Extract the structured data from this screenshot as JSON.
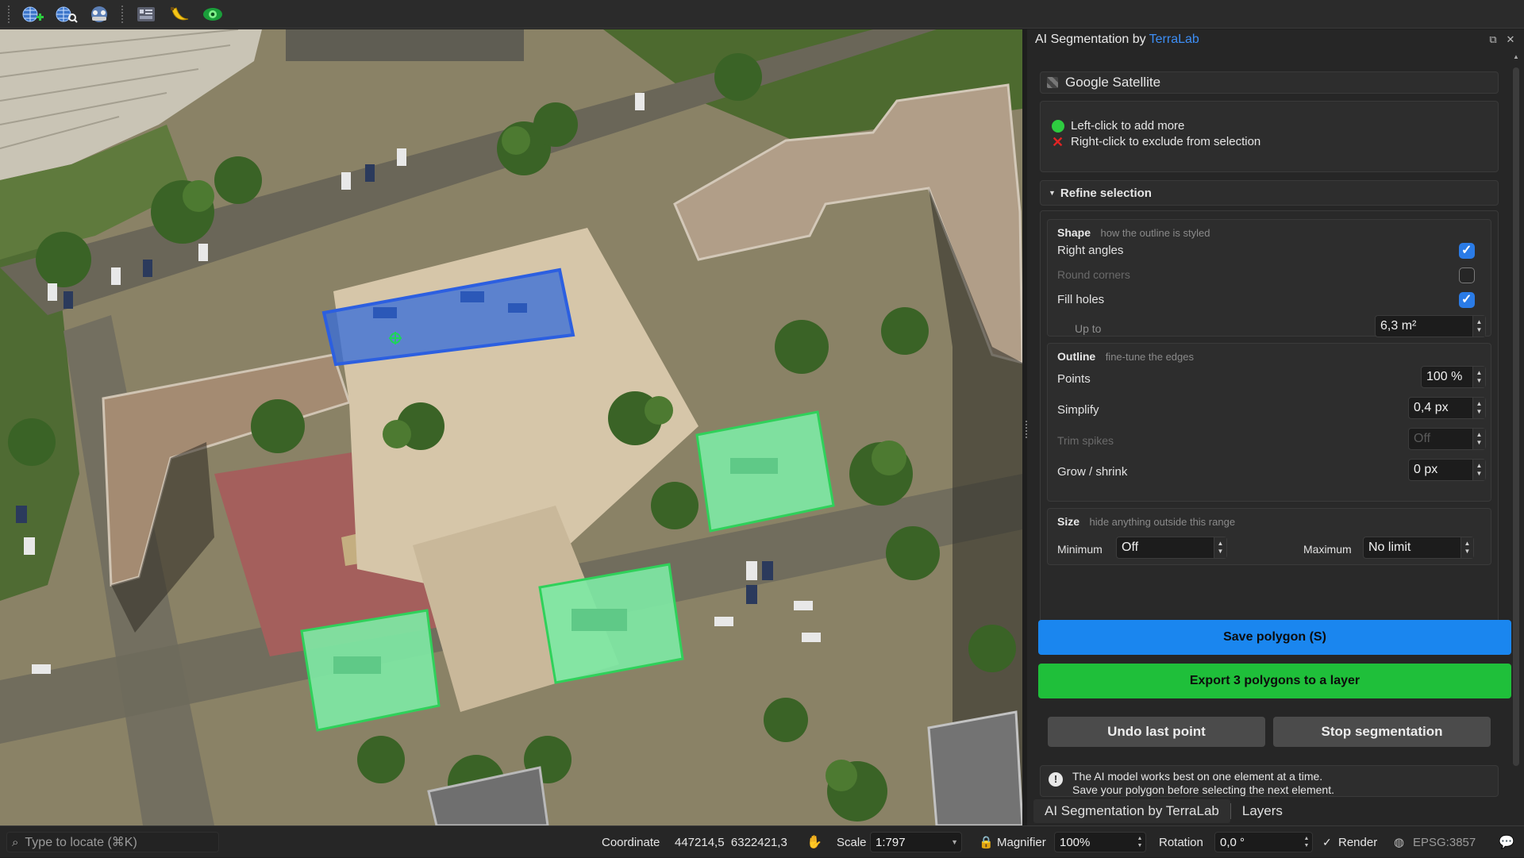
{
  "toolbar": {
    "icons": [
      "add-globe-icon",
      "zoom-globe-icon",
      "segmentation-icon",
      "layout-icon",
      "banana-icon",
      "eye-icon"
    ]
  },
  "panel": {
    "title": "AI Segmentation by",
    "brand": "TerraLab",
    "layer": "Google Satellite",
    "instructions": {
      "left": "Left-click to add more",
      "right": "Right-click to exclude from selection"
    },
    "refine": {
      "title": "Refine selection",
      "shape": {
        "title": "Shape",
        "hint": "how the outline is styled",
        "right_angles": {
          "label": "Right angles",
          "checked": true
        },
        "round_corners": {
          "label": "Round corners",
          "checked": false
        },
        "fill_holes": {
          "label": "Fill holes",
          "checked": true
        },
        "up_to": {
          "label": "Up to",
          "value": "6,3 m²"
        }
      },
      "outline": {
        "title": "Outline",
        "hint": "fine-tune the edges",
        "points": {
          "label": "Points",
          "value": "100 %"
        },
        "simplify": {
          "label": "Simplify",
          "value": "0,4 px"
        },
        "trim_spikes": {
          "label": "Trim spikes",
          "value": "Off"
        },
        "grow_shrink": {
          "label": "Grow / shrink",
          "value": "0 px"
        }
      },
      "size": {
        "title": "Size",
        "hint": "hide anything outside this range",
        "minimum": {
          "label": "Minimum",
          "value": "Off"
        },
        "maximum": {
          "label": "Maximum",
          "value": "No limit"
        }
      }
    },
    "buttons": {
      "save": "Save polygon (S)",
      "export": "Export 3 polygons to a layer",
      "undo": "Undo last point",
      "stop": "Stop segmentation"
    },
    "info": {
      "line1": "The AI model works best on one element at a time.",
      "line2": "Save your polygon before selecting the next element."
    },
    "tabs": [
      "AI Segmentation by TerraLab",
      "Layers"
    ]
  },
  "statusbar": {
    "locate_placeholder": "Type to locate (⌘K)",
    "coordinate_label": "Coordinate",
    "coordinate_value": "447214,5  6322421,3",
    "scale_label": "Scale",
    "scale_value": "1:797",
    "magnifier_label": "Magnifier",
    "magnifier_value": "100%",
    "rotation_label": "Rotation",
    "rotation_value": "0,0 °",
    "render_label": "Render",
    "crs": "EPSG:3857"
  },
  "colors": {
    "accent_blue": "#1a86ef",
    "export_green": "#1fbf3a",
    "selection_green": "#7ee8a4",
    "selection_blue": "#3a6ed8",
    "brand": "#3d8ef5"
  }
}
